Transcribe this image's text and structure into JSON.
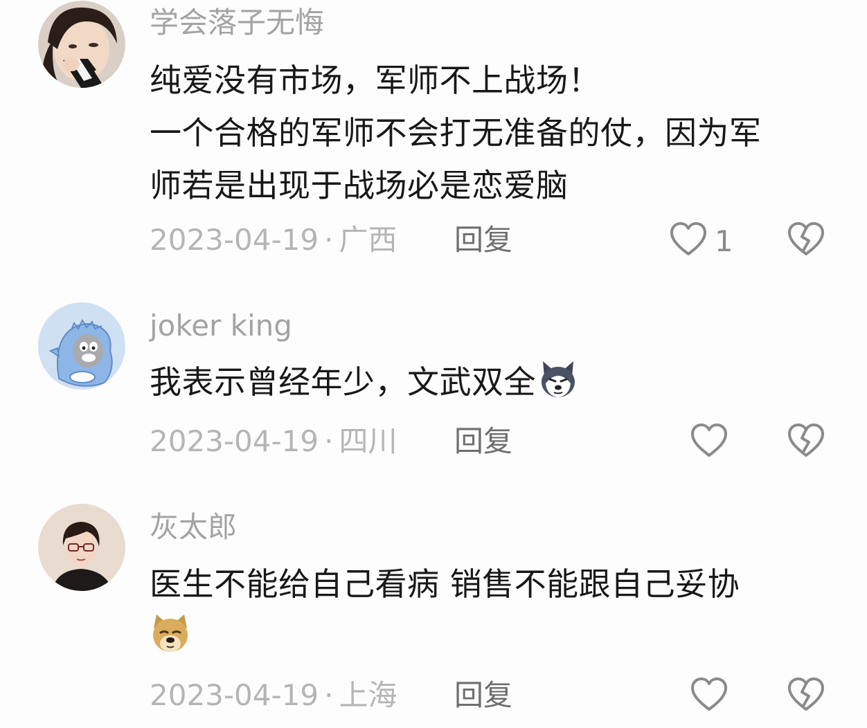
{
  "comments": [
    {
      "username": "学会落子无悔",
      "lines": [
        "纯爱没有市场，军师不上战场！",
        "一个合格的军师不会打无准备的仗，因为军",
        "师若是出现于战场必是恋爱脑"
      ],
      "date": "2023-04-19",
      "location": "广西",
      "reply_label": "回复",
      "like_count": "1",
      "avatar": "girl-portrait"
    },
    {
      "username": "joker king",
      "lines": [
        "我表示曾经年少，文武双全"
      ],
      "emoji": "husky-dog-emoji",
      "date": "2023-04-19",
      "location": "四川",
      "reply_label": "回复",
      "like_count": "",
      "avatar": "tom-cat-dino-costume"
    },
    {
      "username": "灰太郎",
      "lines": [
        "医生不能给自己看病 销售不能跟自己妥协"
      ],
      "emoji": "doge-emoji",
      "date": "2023-04-19",
      "location": "上海",
      "reply_label": "回复",
      "like_count": "",
      "avatar": "boy-with-glasses-portrait"
    }
  ],
  "colors": {
    "background": "#fdfdfd",
    "username": "#a3a3a3",
    "text": "#181818",
    "meta": "#b5b5b5",
    "reply": "#6e6e6e",
    "icon": "#8a8a8a"
  }
}
